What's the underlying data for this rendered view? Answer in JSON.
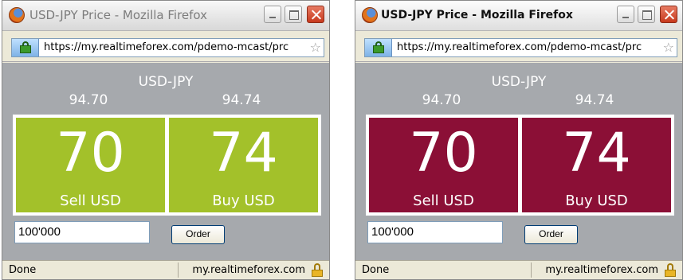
{
  "windows": [
    {
      "title": "USD-JPY Price - Mozilla Firefox",
      "url": "https://my.realtimeforex.com/pdemo-mcast/prc",
      "pair": "USD-JPY",
      "sell_price": "94.70",
      "buy_price": "94.74",
      "sell_pips": "70",
      "buy_pips": "74",
      "sell_label": "Sell USD",
      "buy_label": "Buy USD",
      "amount": "100'000",
      "order_label": "Order",
      "status": "Done",
      "status_host": "my.realtimeforex.com",
      "tile_color": "#a3c12a"
    },
    {
      "title": "USD-JPY Price - Mozilla Firefox",
      "url": "https://my.realtimeforex.com/pdemo-mcast/prc",
      "pair": "USD-JPY",
      "sell_price": "94.70",
      "buy_price": "94.74",
      "sell_pips": "70",
      "buy_pips": "74",
      "sell_label": "Sell USD",
      "buy_label": "Buy USD",
      "amount": "100'000",
      "order_label": "Order",
      "status": "Done",
      "status_host": "my.realtimeforex.com",
      "tile_color": "#8b0f36"
    }
  ]
}
